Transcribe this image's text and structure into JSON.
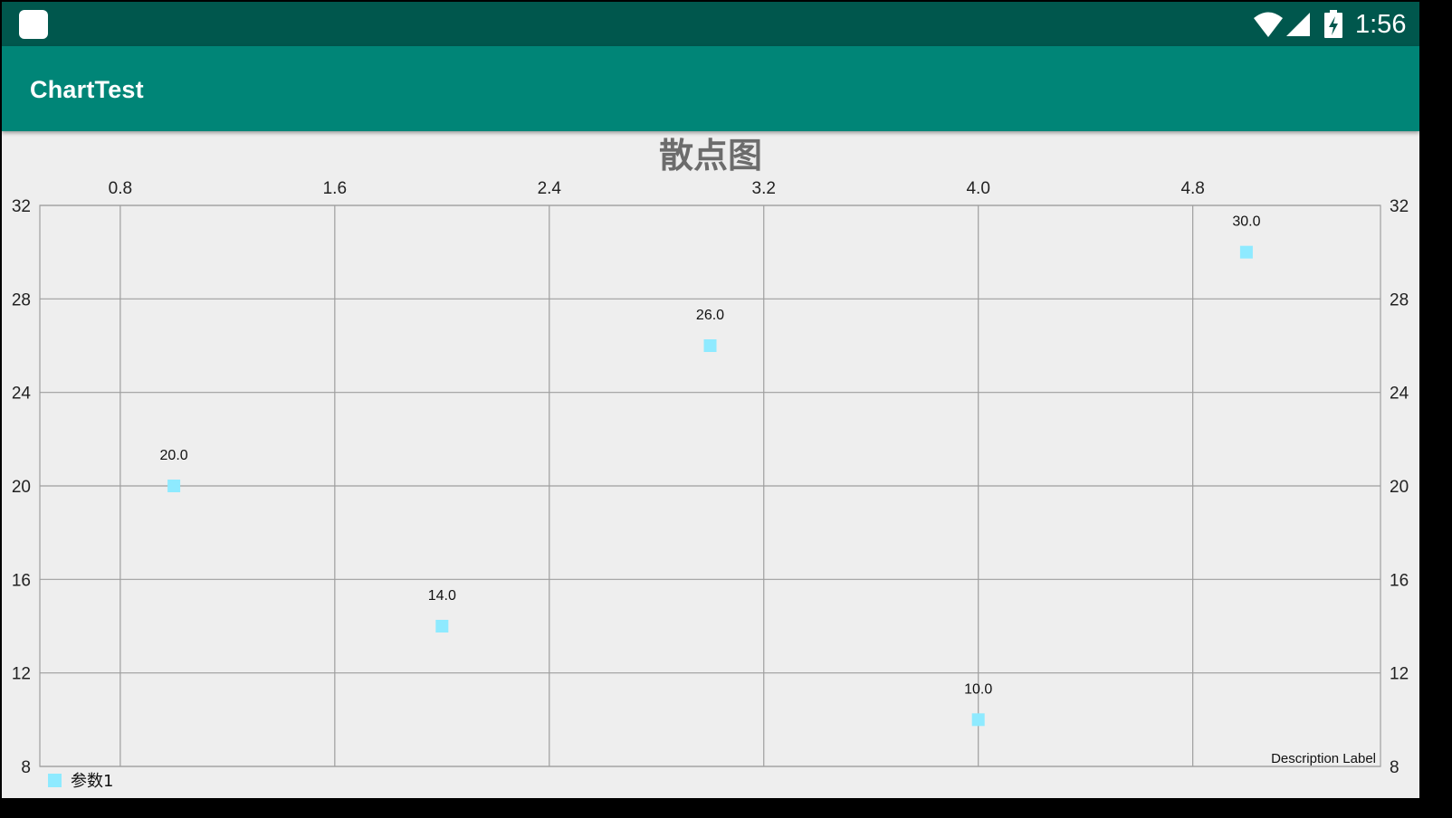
{
  "status_bar": {
    "time": "1:56",
    "icons": [
      "app-notification-icon",
      "wifi-icon",
      "cell-signal-icon",
      "battery-charging-icon"
    ]
  },
  "app_bar": {
    "title": "ChartTest"
  },
  "colors": {
    "status_bar": "#00574d",
    "app_bar": "#008577",
    "background": "#eeeeee",
    "point": "#8eeaff",
    "grid": "#9e9e9e"
  },
  "chart_data": {
    "type": "scatter",
    "title": "散点图",
    "x_ticks": [
      "0.8",
      "1.6",
      "2.4",
      "3.2",
      "4.0",
      "4.8"
    ],
    "x_tick_values": [
      0.8,
      1.6,
      2.4,
      3.2,
      4.0,
      4.8
    ],
    "y_ticks": [
      "32",
      "28",
      "24",
      "20",
      "16",
      "12",
      "8"
    ],
    "y_tick_values": [
      32,
      28,
      24,
      20,
      16,
      12,
      8
    ],
    "xlim": [
      0.5,
      5.5
    ],
    "ylim": [
      8,
      32
    ],
    "x_axis_position": "top",
    "y_axis_position": "both",
    "grid": true,
    "series": [
      {
        "name": "参数1",
        "x": [
          1,
          2,
          3,
          4,
          5
        ],
        "y": [
          20,
          14,
          26,
          10,
          30
        ],
        "labels": [
          "20.0",
          "14.0",
          "26.0",
          "10.0",
          "30.0"
        ]
      }
    ],
    "legend": {
      "position": "bottom-left",
      "entries": [
        "参数1"
      ]
    },
    "description": "Description Label"
  }
}
